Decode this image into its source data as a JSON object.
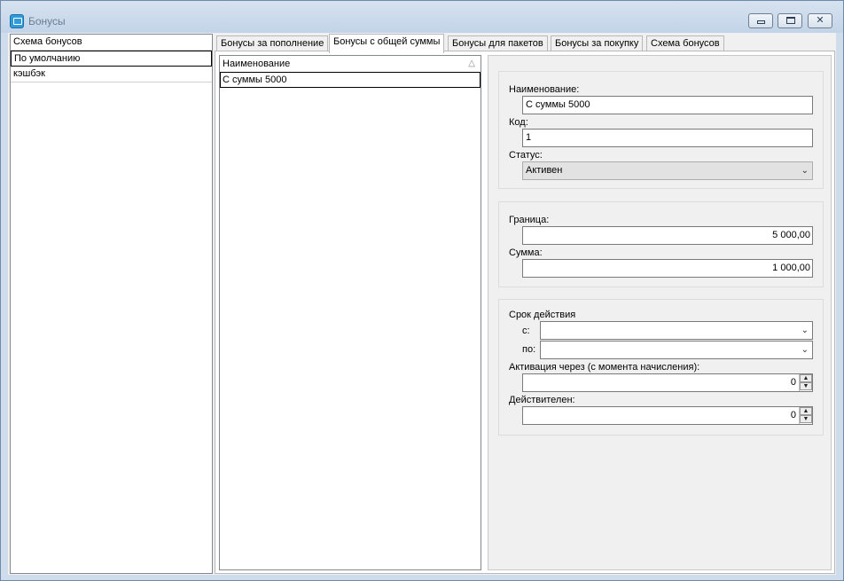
{
  "window": {
    "title": "Бонусы"
  },
  "left_list": {
    "items": [
      "Схема бонусов",
      "По умолчанию",
      "кэшбэк"
    ]
  },
  "tabs": [
    "Бонусы за пополнение",
    "Бонусы с общей суммы",
    "Бонусы для пакетов",
    "Бонусы за покупку",
    "Схема бонусов"
  ],
  "grid": {
    "header": "Наименование",
    "rows": [
      "С суммы 5000"
    ]
  },
  "form": {
    "name_label": "Наименование:",
    "name_value": "С суммы 5000",
    "code_label": "Код:",
    "code_value": "1",
    "status_label": "Статус:",
    "status_value": "Активен",
    "limit_label": "Граница:",
    "limit_value": "5 000,00",
    "sum_label": "Сумма:",
    "sum_value": "1 000,00",
    "validity_label": "Срок действия",
    "from_label": "с:",
    "to_label": "по:",
    "activation_label": "Активация через (с момента начисления):",
    "activation_value": "0",
    "valid_label": "Действителен:",
    "valid_value": "0"
  }
}
